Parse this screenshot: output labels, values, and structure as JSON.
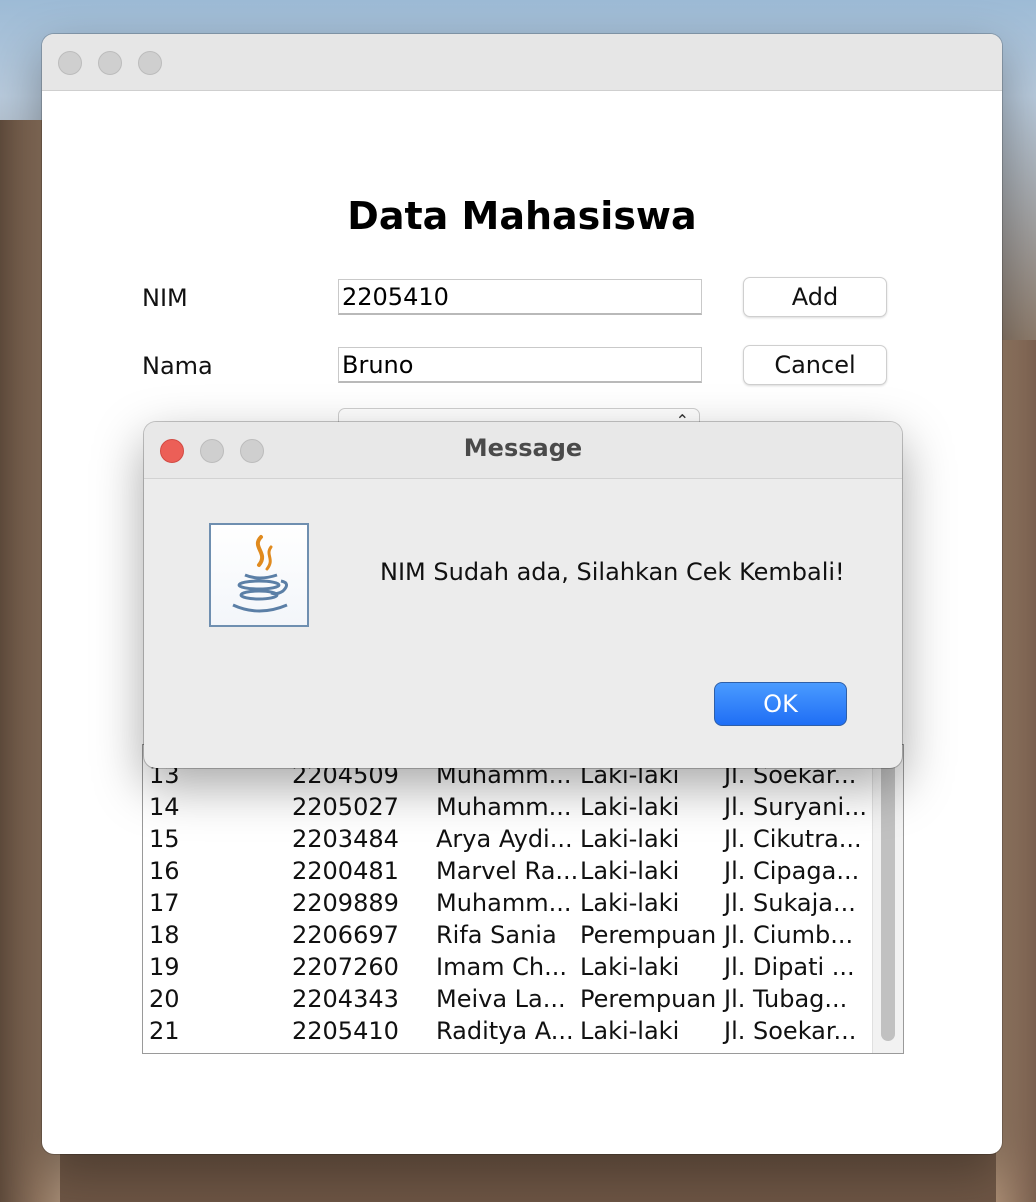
{
  "main_window": {
    "form_title": "Data Mahasiswa",
    "labels": {
      "nim": "NIM",
      "nama": "Nama"
    },
    "fields": {
      "nim_value": "2205410",
      "nama_value": "Bruno"
    },
    "buttons": {
      "add": "Add",
      "cancel": "Cancel"
    }
  },
  "table": {
    "rows": [
      [
        "13",
        "2204509",
        "Muhamm...",
        "Laki-laki",
        "Jl. Soekar..."
      ],
      [
        "14",
        "2205027",
        "Muhamm...",
        "Laki-laki",
        "Jl. Suryani..."
      ],
      [
        "15",
        "2203484",
        "Arya Aydi...",
        "Laki-laki",
        "Jl. Cikutra..."
      ],
      [
        "16",
        "2200481",
        "Marvel Ra...",
        "Laki-laki",
        "Jl. Cipaga..."
      ],
      [
        "17",
        "2209889",
        "Muhamm...",
        "Laki-laki",
        "Jl. Sukaja..."
      ],
      [
        "18",
        "2206697",
        "Rifa Sania",
        "Perempuan",
        "Jl. Ciumb..."
      ],
      [
        "19",
        "2207260",
        "Imam Ch...",
        "Laki-laki",
        "Jl. Dipati ..."
      ],
      [
        "20",
        "2204343",
        "Meiva La...",
        "Perempuan",
        "Jl. Tubag..."
      ],
      [
        "21",
        "2205410",
        "Raditya A...",
        "Laki-laki",
        "Jl. Soekar..."
      ]
    ]
  },
  "dialog": {
    "title": "Message",
    "message": "NIM Sudah ada, Silahkan Cek Kembali!",
    "ok_label": "OK",
    "icon": "java-icon"
  },
  "colors": {
    "close_red": "#ec5f57",
    "ok_blue": "#1f6ef5"
  }
}
